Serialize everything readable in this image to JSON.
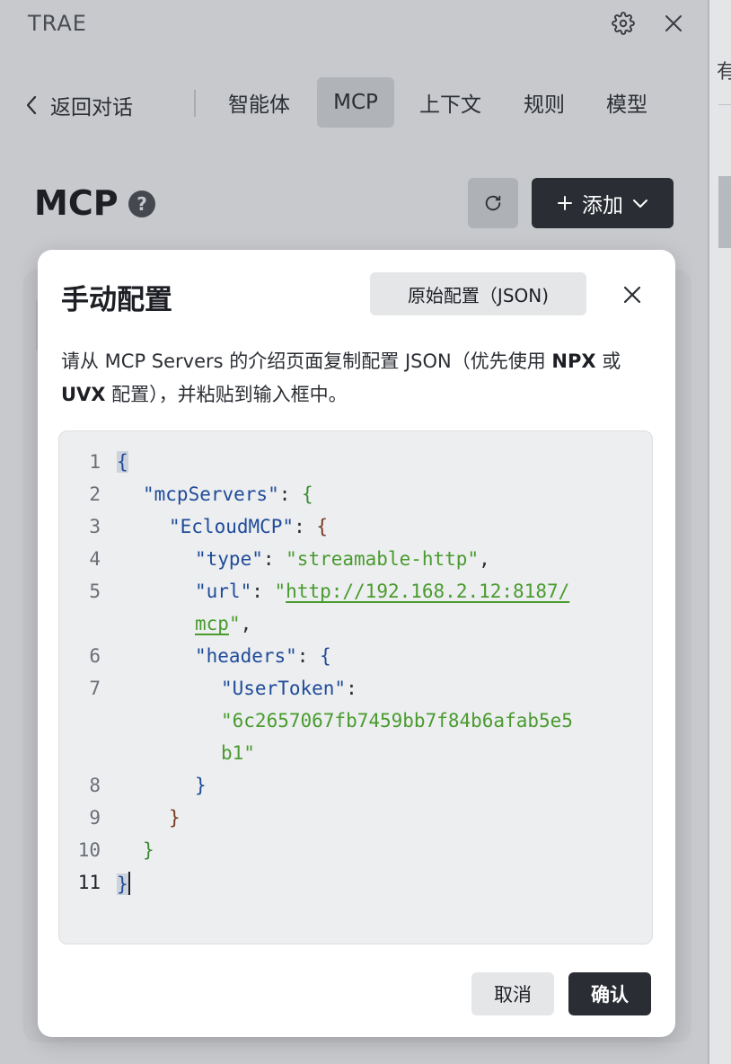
{
  "app": {
    "title": "TRAE"
  },
  "top_icons": {
    "settings": "gear-icon",
    "close": "close-icon"
  },
  "right_strip": {
    "char": "有"
  },
  "nav": {
    "back_label": "返回对话",
    "tabs": [
      {
        "label": "智能体",
        "active": false
      },
      {
        "label": "MCP",
        "active": true
      },
      {
        "label": "上下文",
        "active": false
      },
      {
        "label": "规则",
        "active": false
      },
      {
        "label": "模型",
        "active": false
      }
    ]
  },
  "section": {
    "title": "MCP",
    "help": "?",
    "add_label": "添加"
  },
  "modal": {
    "title": "手动配置",
    "raw_button": "原始配置（JSON)",
    "desc_part1": "请从 MCP Servers 的介绍页面复制配置 JSON（优先使用 ",
    "desc_bold1": "NPX",
    "desc_part2": " 或 ",
    "desc_bold2": "UVX",
    "desc_part3": " 配置），并粘贴到输入框中。",
    "cancel": "取消",
    "confirm": "确认"
  },
  "code": {
    "line_numbers": [
      "1",
      "2",
      "3",
      "4",
      "5",
      "6",
      "7",
      "8",
      "9",
      "10",
      "11"
    ],
    "open_brace": "{",
    "close_brace": "}",
    "key_mcpServers": "\"mcpServers\"",
    "key_server": "\"EcloudMCP\"",
    "key_type": "\"type\"",
    "val_type": "\"streamable-http\"",
    "key_url": "\"url\"",
    "val_url_q": "\"",
    "val_url_1": "http://192.168.2.12:8187/",
    "val_url_2": "mcp",
    "key_headers": "\"headers\"",
    "key_token": "\"UserToken\"",
    "val_token_1": "\"6c2657067fb7459bb7f84b6afab5e5",
    "val_token_2": "b1\"",
    "colon": ": ",
    "colon_end": ":",
    "comma": ","
  },
  "colors": {
    "accent_dark": "#2a2d33",
    "string_green": "#4a9b2e",
    "key_blue": "#1f4b99"
  }
}
